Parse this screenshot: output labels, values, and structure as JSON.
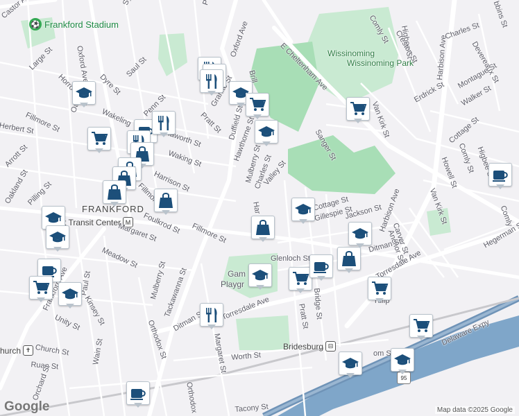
{
  "map": {
    "attribution": "Map data ©2025 Google",
    "logo": "Google",
    "colors": {
      "background": "#f2f1f4",
      "road": "#ffffff",
      "park": "#c9ead2",
      "park_dark": "#a8deb6",
      "water": "#7fa6c9",
      "highway": "#6f93b7",
      "pin_icon": "#1c4f7a"
    }
  },
  "places": {
    "stadium": "Frankford Stadium",
    "park": "Wissinoming Park",
    "frankford": "FRANKFORD",
    "transit_center": "Arrott Transit Center",
    "bridesburg": "Bridesburg",
    "gambrel_1": "Gam",
    "gambrel_2": "Playgr",
    "church": "hurch",
    "highway_shield": "95"
  },
  "streets": {
    "s01": "Castor Av",
    "s02": "Large St",
    "s03": "Horrocks St",
    "s04": "Oxford Ave",
    "s05": "Dyre St",
    "s06": "Saul St",
    "s07": "Sylvester",
    "s08": "Penn St",
    "s09": "Oak",
    "s10": "Fillmore St",
    "s11": "Wakeling",
    "s12": "Penn St",
    "s13": "Herbert St",
    "s14": "Arrott St",
    "s15": "Oakland St",
    "s16": "Pilling St",
    "s17": "Haworth St",
    "s18": "Waking St",
    "s19": "Harrison St",
    "s20": "Fillmore St",
    "s21": "Foulkrod St",
    "s22": "Margaret St",
    "s23": "Meadow St",
    "s24": "Fillmore St",
    "s25": "Pratt St",
    "s26": "Granite St",
    "s27": "Duffield St",
    "s28": "Hawthorne St",
    "s29": "Mulberry St",
    "s30": "Charles St",
    "s31": "Valley St",
    "s32": "Har",
    "s33": "Glenloch St",
    "s34": "Mulberry St",
    "s35": "Tackawanna St",
    "s36": "Ditman St",
    "s37": "Orthodox St",
    "s38": "Margaret St",
    "s39": "Orthodox",
    "s40": "Torresdale Ave",
    "s41": "Worth St",
    "s42": "Church St",
    "s43": "Ruan St",
    "s44": "Unity St",
    "s45": "Kinsey St",
    "s46": "Paul St",
    "s47": "Wain St",
    "s48": "Frankford Ave",
    "s49": "Tacony St",
    "s50": "Pratt St",
    "s51": "Bridge St",
    "s52": "E Cheltenham Ave",
    "s53": "Comly St",
    "s54": "Higbee St",
    "s55": "Creston St",
    "s56": "Charles St",
    "s57": "Devereaux St",
    "s58": "Harbison Ave",
    "s59": "Erdrick St",
    "s60": "Van Kirk St",
    "s61": "Sanger St",
    "s62": "Montague St",
    "s63": "Walker St",
    "s64": "Cottage St",
    "s65": "Comly St",
    "s66": "Howell St",
    "s67": "Higbee St",
    "s68": "Van Kirk St",
    "s69": "Cottage St",
    "s70": "Gillespie St",
    "s71": "Jackson St",
    "s72": "Harbison Ave",
    "s73": "Anchor St",
    "s74": "Carver St",
    "s75": "Ditman St",
    "s76": "Torresdale Ave",
    "s77": "Tulip",
    "s78": "Hegerman St",
    "s79": "Delaware Expy",
    "s80": "om St",
    "s81": "Comly",
    "s82": "Orchard St",
    "s83": "bbins St",
    "s84": "Oxford Ave",
    "s85": "Brill"
  },
  "pins": [
    {
      "type": "school-icon"
    },
    {
      "type": "restaurant-icon"
    },
    {
      "type": "school-icon"
    },
    {
      "type": "restaurant-icon"
    },
    {
      "type": "school-icon"
    },
    {
      "type": "cart-icon"
    },
    {
      "type": "coffee-icon"
    },
    {
      "type": "restaurant-icon"
    },
    {
      "type": "cart-icon"
    },
    {
      "type": "restaurant-icon"
    },
    {
      "type": "bag-icon"
    },
    {
      "type": "bag-icon"
    },
    {
      "type": "bag-icon"
    },
    {
      "type": "bag-icon"
    },
    {
      "type": "bag-icon"
    },
    {
      "type": "school-icon"
    },
    {
      "type": "school-icon"
    },
    {
      "type": "coffee-icon"
    },
    {
      "type": "cart-icon"
    },
    {
      "type": "school-icon"
    },
    {
      "type": "restaurant-icon"
    },
    {
      "type": "bag-icon"
    },
    {
      "type": "school-icon"
    },
    {
      "type": "cart-icon"
    },
    {
      "type": "coffee-icon"
    },
    {
      "type": "bag-icon"
    },
    {
      "type": "school-icon"
    },
    {
      "type": "cart-icon"
    },
    {
      "type": "cart-icon"
    },
    {
      "type": "school-icon"
    },
    {
      "type": "school-icon"
    },
    {
      "type": "coffee-icon"
    },
    {
      "type": "school-icon"
    },
    {
      "type": "coffee-icon"
    },
    {
      "type": "cart-icon"
    },
    {
      "type": "school-icon"
    }
  ]
}
